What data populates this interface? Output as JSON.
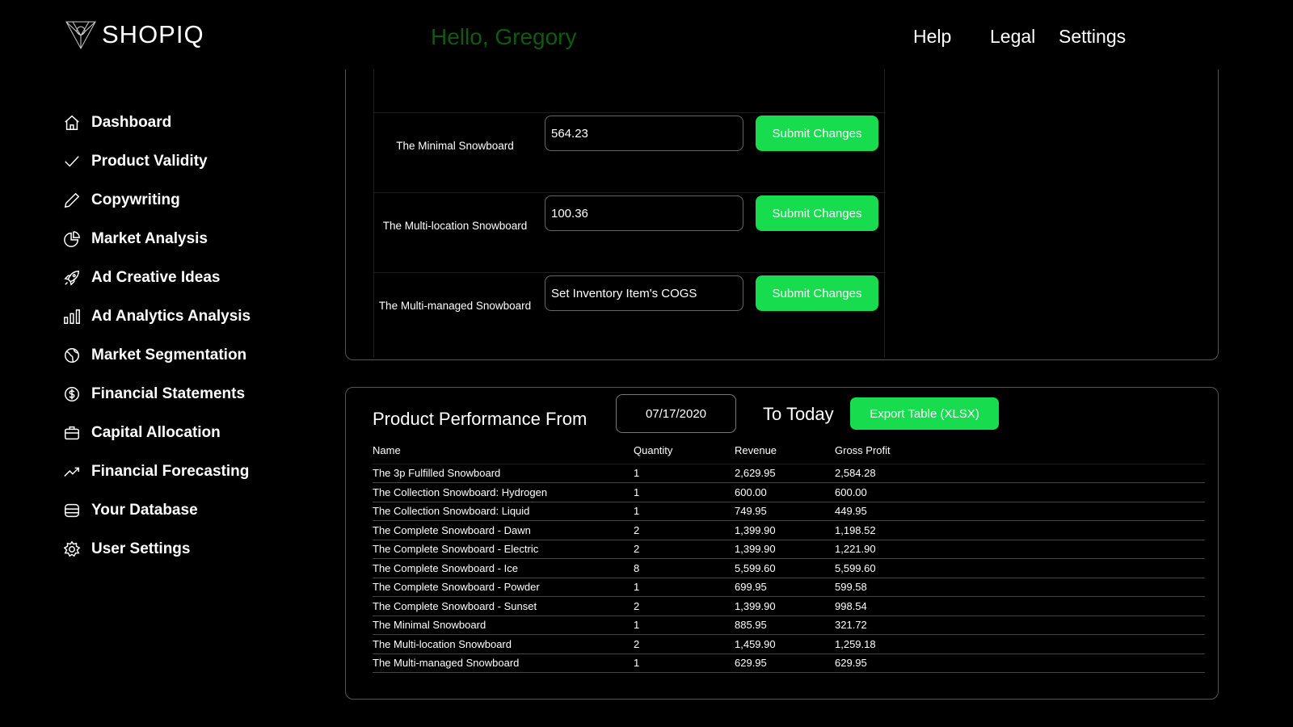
{
  "app": {
    "name": "SHOPIQ",
    "greeting": "Hello, Gregory"
  },
  "topnav": [
    {
      "label": "Help"
    },
    {
      "label": "Legal"
    },
    {
      "label": "Settings"
    }
  ],
  "sidebar": {
    "items": [
      {
        "label": "Dashboard",
        "icon": "home-icon"
      },
      {
        "label": "Product Validity",
        "icon": "check-icon"
      },
      {
        "label": "Copywriting",
        "icon": "pencil-icon"
      },
      {
        "label": "Market Analysis",
        "icon": "pie-chart-icon"
      },
      {
        "label": "Ad Creative Ideas",
        "icon": "rocket-icon"
      },
      {
        "label": "Ad Analytics Analysis",
        "icon": "bar-chart-icon"
      },
      {
        "label": "Market Segmentation",
        "icon": "globe-icon"
      },
      {
        "label": "Financial Statements",
        "icon": "dollar-icon"
      },
      {
        "label": "Capital Allocation",
        "icon": "briefcase-icon"
      },
      {
        "label": "Financial Forecasting",
        "icon": "trend-up-icon"
      },
      {
        "label": "Your Database",
        "icon": "database-icon"
      },
      {
        "label": "User Settings",
        "icon": "gear-icon"
      }
    ]
  },
  "cogs": {
    "placeholder": "Set Inventory Item's COGS",
    "submit_label": "Submit Changes",
    "rows": [
      {
        "name": "The Minimal Snowboard",
        "value": "564.23"
      },
      {
        "name": "The Multi-location Snowboard",
        "value": "100.36"
      },
      {
        "name": "The Multi-managed Snowboard",
        "value": ""
      }
    ]
  },
  "performance": {
    "title": "Product Performance From",
    "from_date": "07/17/2020",
    "to_label": "To Today",
    "export_label": "Export Table (XLSX)",
    "columns": [
      "Name",
      "Quantity",
      "Revenue",
      "Gross Profit"
    ],
    "rows": [
      [
        "The 3p Fulfilled Snowboard",
        "1",
        "2,629.95",
        "2,584.28"
      ],
      [
        "The Collection Snowboard: Hydrogen",
        "1",
        "600.00",
        "600.00"
      ],
      [
        "The Collection Snowboard: Liquid",
        "1",
        "749.95",
        "449.95"
      ],
      [
        "The Complete Snowboard - Dawn",
        "2",
        "1,399.90",
        "1,198.52"
      ],
      [
        "The Complete Snowboard - Electric",
        "2",
        "1,399.90",
        "1,221.90"
      ],
      [
        "The Complete Snowboard - Ice",
        "8",
        "5,599.60",
        "5,599.60"
      ],
      [
        "The Complete Snowboard - Powder",
        "1",
        "699.95",
        "599.58"
      ],
      [
        "The Complete Snowboard - Sunset",
        "2",
        "1,399.90",
        "998.54"
      ],
      [
        "The Minimal Snowboard",
        "1",
        "885.95",
        "321.72"
      ],
      [
        "The Multi-location Snowboard",
        "2",
        "1,459.90",
        "1,259.18"
      ],
      [
        "The Multi-managed Snowboard",
        "1",
        "629.95",
        "629.95"
      ]
    ]
  },
  "colors": {
    "accent": "#16dc4e",
    "greeting": "#0e5a10",
    "background": "#000000"
  }
}
